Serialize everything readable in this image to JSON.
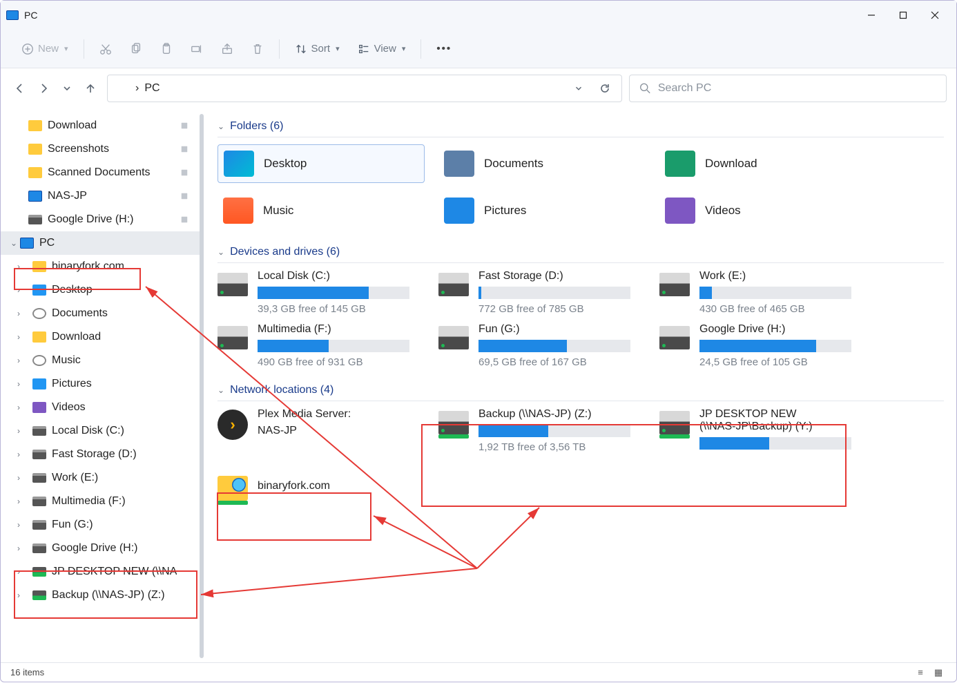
{
  "window": {
    "title": "PC"
  },
  "toolbar": {
    "new": "New",
    "sort": "Sort",
    "view": "View"
  },
  "address": {
    "location": "PC"
  },
  "search": {
    "placeholder": "Search PC"
  },
  "sidebar": {
    "pinned": [
      {
        "label": "Download",
        "icon": "dl"
      },
      {
        "label": "Screenshots",
        "icon": "folder"
      },
      {
        "label": "Scanned Documents",
        "icon": "folder"
      },
      {
        "label": "NAS-JP",
        "icon": "pc"
      },
      {
        "label": "Google Drive (H:)",
        "icon": "drive"
      }
    ],
    "pc_label": "PC",
    "pc_children": [
      {
        "label": "binaryfork.com",
        "icon": "folder"
      },
      {
        "label": "Desktop",
        "icon": "blue"
      },
      {
        "label": "Documents",
        "icon": "disk"
      },
      {
        "label": "Download",
        "icon": "dl"
      },
      {
        "label": "Music",
        "icon": "disk"
      },
      {
        "label": "Pictures",
        "icon": "pic"
      },
      {
        "label": "Videos",
        "icon": "vid"
      },
      {
        "label": "Local Disk (C:)",
        "icon": "drive"
      },
      {
        "label": "Fast Storage (D:)",
        "icon": "drive"
      },
      {
        "label": "Work (E:)",
        "icon": "drive"
      },
      {
        "label": "Multimedia (F:)",
        "icon": "drive"
      },
      {
        "label": "Fun (G:)",
        "icon": "drive"
      },
      {
        "label": "Google Drive (H:)",
        "icon": "drive"
      },
      {
        "label": "JP DESKTOP NEW (\\\\NAS-JP\\Backup) (Y:)",
        "icon": "net",
        "clip": "JP DESKTOP NEW (\\\\NA"
      },
      {
        "label": "Backup (\\\\NAS-JP) (Z:)",
        "icon": "net"
      }
    ]
  },
  "groups": {
    "folders": {
      "title": "Folders (6)"
    },
    "drives": {
      "title": "Devices and drives (6)"
    },
    "network": {
      "title": "Network locations (4)"
    }
  },
  "folders": [
    {
      "label": "Desktop",
      "icon": "desktop",
      "selected": true
    },
    {
      "label": "Documents",
      "icon": "docs"
    },
    {
      "label": "Download",
      "icon": "dl"
    },
    {
      "label": "Music",
      "icon": "music2"
    },
    {
      "label": "Pictures",
      "icon": "pics"
    },
    {
      "label": "Videos",
      "icon": "vids"
    }
  ],
  "drives": [
    {
      "name": "Local Disk (C:)",
      "free": "39,3 GB free of 145 GB",
      "pct": 73
    },
    {
      "name": "Fast Storage (D:)",
      "free": "772 GB free of 785 GB",
      "pct": 2
    },
    {
      "name": "Work (E:)",
      "free": "430 GB free of 465 GB",
      "pct": 8
    },
    {
      "name": "Multimedia (F:)",
      "free": "490 GB free of 931 GB",
      "pct": 47
    },
    {
      "name": "Fun (G:)",
      "free": "69,5 GB free of 167 GB",
      "pct": 58
    },
    {
      "name": "Google Drive (H:)",
      "free": "24,5 GB free of 105 GB",
      "pct": 77
    }
  ],
  "network": {
    "plex_line1": "Plex Media Server:",
    "plex_line2": "NAS-JP",
    "backup": {
      "name": "Backup (\\\\NAS-JP) (Z:)",
      "free": "1,92 TB free of 3,56 TB",
      "pct": 46
    },
    "jpnew": {
      "name_line1": "JP DESKTOP NEW",
      "name_line2": "(\\\\NAS-JP\\Backup) (Y:)",
      "pct": 46
    },
    "binaryfork": "binaryfork.com"
  },
  "status": {
    "count": "16 items"
  }
}
